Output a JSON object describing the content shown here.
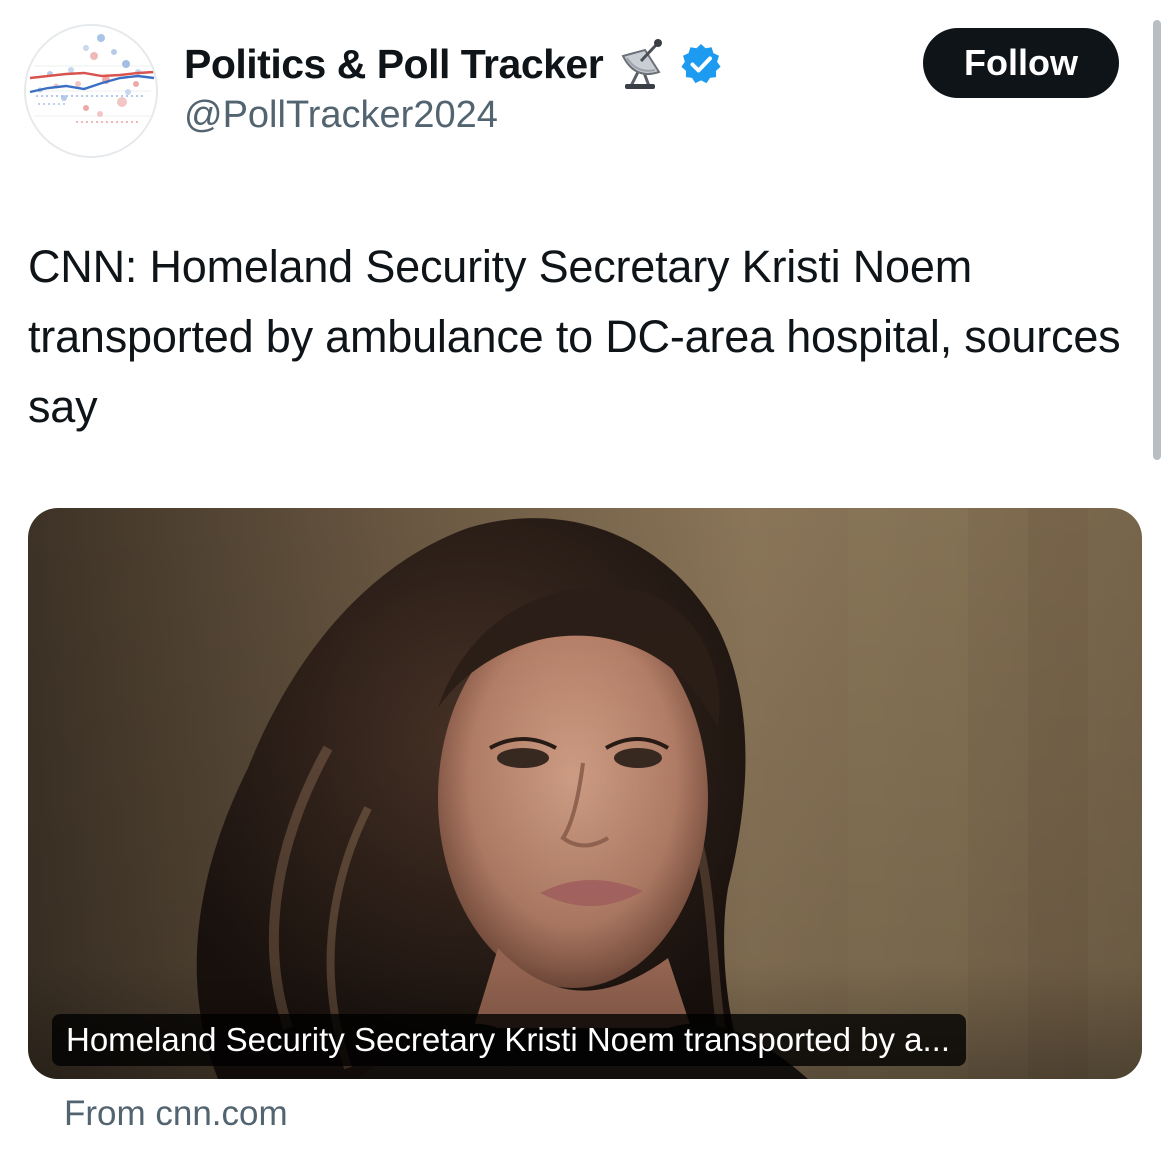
{
  "author": {
    "display_name": "Politics & Poll Tracker",
    "handle": "@PollTracker2024",
    "avatar_icon": "poll-chart-avatar",
    "name_emoji_icon": "satellite-antenna-icon",
    "verified_icon": "verified-badge-icon",
    "verified_color": "#1d9bf0"
  },
  "follow_button": {
    "label": "Follow",
    "background": "#0f1419"
  },
  "tweet": {
    "text": "CNN: Homeland Security Secretary Kristi Noem transported by ambulance to DC-area hospital, sources say"
  },
  "link_card": {
    "caption": "Homeland Security Secretary Kristi Noem transported by a...",
    "source": "From cnn.com"
  }
}
